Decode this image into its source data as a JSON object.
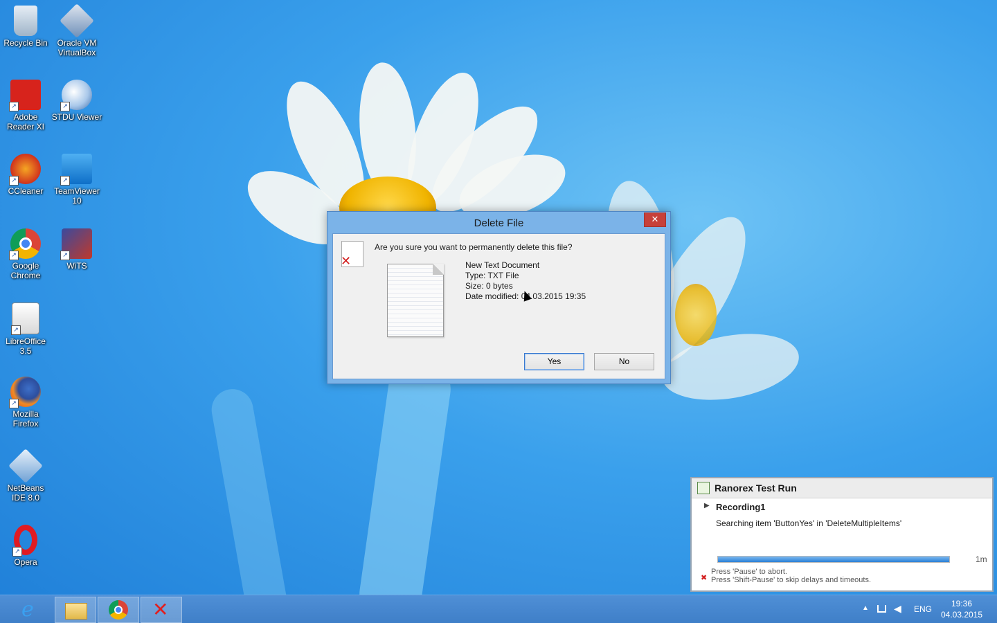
{
  "desktop": {
    "icons": [
      {
        "label": "Recycle Bin"
      },
      {
        "label": "Oracle VM VirtualBox"
      },
      {
        "label": "Adobe Reader XI"
      },
      {
        "label": "STDU Viewer"
      },
      {
        "label": "CCleaner"
      },
      {
        "label": "TeamViewer 10"
      },
      {
        "label": "Google Chrome"
      },
      {
        "label": "WiTS"
      },
      {
        "label": "LibreOffice 3.5"
      },
      {
        "label": "Mozilla Firefox"
      },
      {
        "label": "NetBeans IDE 8.0"
      },
      {
        "label": "Opera"
      }
    ]
  },
  "dialog": {
    "title": "Delete File",
    "close_glyph": "✕",
    "question": "Are you sure you want to permanently delete this file?",
    "file_name": "New Text Document",
    "file_type": "Type: TXT File",
    "file_size": "Size: 0 bytes",
    "date_modified": "Date modified: 04.03.2015 19:35",
    "yes_label": "Yes",
    "no_label": "No"
  },
  "ranorex": {
    "title": "Ranorex Test Run",
    "recording": "Recording1",
    "status": "Searching item 'ButtonYes' in 'DeleteMultipleItems'",
    "progress_fraction": 1.0,
    "progress_time": "1m",
    "hint1": "Press 'Pause' to abort.",
    "hint2": "Press 'Shift-Pause' to skip delays and timeouts."
  },
  "taskbar": {
    "language": "ENG",
    "time": "19:36",
    "date": "04.03.2015"
  }
}
